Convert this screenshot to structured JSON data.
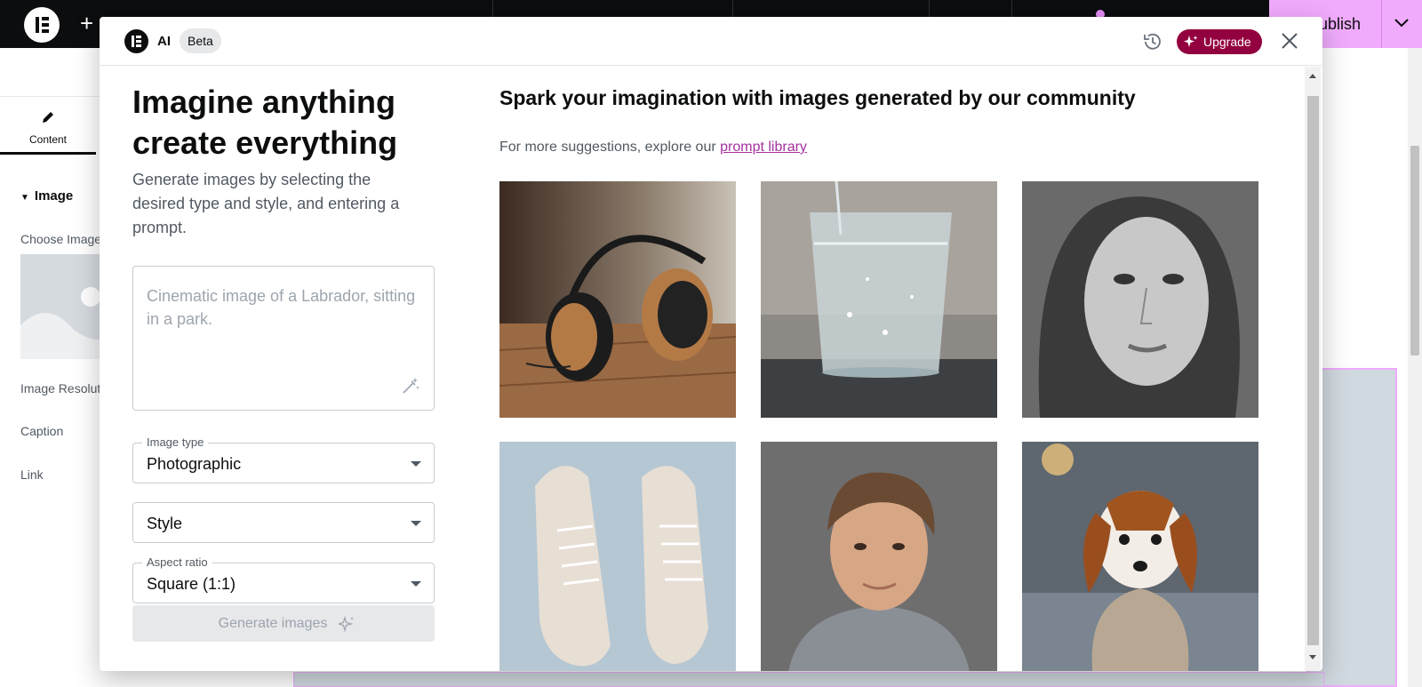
{
  "editor": {
    "publish_label": "Publish",
    "sidebar": {
      "tab_content_label": "Content",
      "section_title": "Image",
      "choose_image_label": "Choose Image",
      "image_resolution_label": "Image Resolution",
      "caption_label": "Caption",
      "link_label": "Link"
    }
  },
  "modal": {
    "header": {
      "ai_label": "AI",
      "beta_badge": "Beta",
      "upgrade_label": "Upgrade"
    },
    "left": {
      "headline": "Imagine anything create everything",
      "subhead": "Generate images by selecting the desired type and style, and entering a prompt.",
      "prompt_placeholder": "Cinematic image of a Labrador, sitting in a park.",
      "image_type": {
        "label": "Image type",
        "value": "Photographic"
      },
      "style": {
        "value": "Style"
      },
      "aspect_ratio": {
        "label": "Aspect ratio",
        "value": "Square (1:1)"
      },
      "generate_label": "Generate images"
    },
    "right": {
      "title": "Spark your imagination with images generated by our community",
      "subtitle_prefix": "For more suggestions, explore our ",
      "prompt_library_link": "prompt library",
      "tiles": [
        {
          "subject": "headphones"
        },
        {
          "subject": "glass-of-water"
        },
        {
          "subject": "woman-portrait-bw"
        },
        {
          "subject": "sneakers"
        },
        {
          "subject": "teen-boy-portrait"
        },
        {
          "subject": "dog-in-sweater"
        }
      ]
    }
  },
  "colors": {
    "brand_pink": "#f0abfc",
    "upgrade_bg": "#93003f",
    "link": "#a4309f"
  }
}
